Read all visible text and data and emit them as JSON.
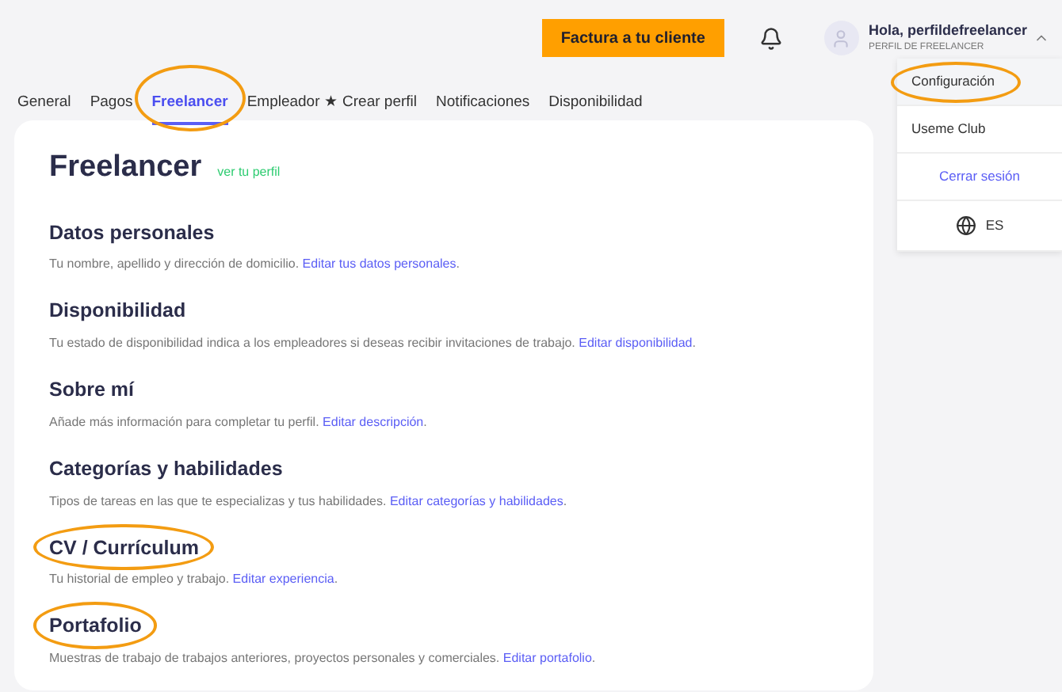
{
  "header": {
    "invoice_button": "Factura a tu cliente",
    "user": {
      "greeting": "Hola, perfildefreelancer",
      "role": "PERFIL DE FREELANCER",
      "menu_expanded": true
    }
  },
  "tabs": [
    {
      "label": "General",
      "selected": false,
      "highlighted": false
    },
    {
      "label": "Pagos",
      "selected": false,
      "highlighted": false
    },
    {
      "label": "Freelancer",
      "selected": true,
      "highlighted": true
    },
    {
      "label": "Empleador ★ Crear perfil",
      "selected": false,
      "highlighted": false
    },
    {
      "label": "Notificaciones",
      "selected": false,
      "highlighted": false
    },
    {
      "label": "Disponibilidad",
      "selected": false,
      "highlighted": false
    }
  ],
  "page": {
    "title": "Freelancer",
    "profile_link": "ver tu perfil"
  },
  "sections": [
    {
      "title": "Datos personales",
      "highlighted": false,
      "description": "Tu nombre, apellido y dirección de domicilio.",
      "link": "Editar tus datos personales",
      "end": "."
    },
    {
      "title": "Disponibilidad",
      "highlighted": false,
      "description": "Tu estado de disponibilidad indica a los empleadores si deseas recibir invitaciones de trabajo.",
      "link": "Editar disponibilidad",
      "end": "."
    },
    {
      "title": "Sobre mí",
      "highlighted": false,
      "description": "Añade más información para completar tu perfil.",
      "link": "Editar descripción",
      "end": "."
    },
    {
      "title": "Categorías y habilidades",
      "highlighted": false,
      "description": "Tipos de tareas en las que te especializas y tus habilidades.",
      "link": "Editar categorías y habilidades",
      "end": "."
    },
    {
      "title": "CV / Currículum",
      "highlighted": true,
      "description": "Tu historial de empleo y trabajo.",
      "link": "Editar experiencia",
      "end": "."
    },
    {
      "title": "Portafolio",
      "highlighted": true,
      "description": "Muestras de trabajo de trabajos anteriores, proyectos personales y comerciales.",
      "link": "Editar portafolio",
      "end": "."
    }
  ],
  "user_menu": [
    {
      "kind": "item",
      "label": "Configuración",
      "selected": true,
      "highlighted": true
    },
    {
      "kind": "item",
      "label": "Useme Club",
      "selected": false,
      "highlighted": false
    },
    {
      "kind": "logout",
      "label": "Cerrar sesión",
      "selected": false,
      "highlighted": false
    },
    {
      "kind": "language",
      "label": "ES",
      "selected": false,
      "highlighted": false
    }
  ]
}
